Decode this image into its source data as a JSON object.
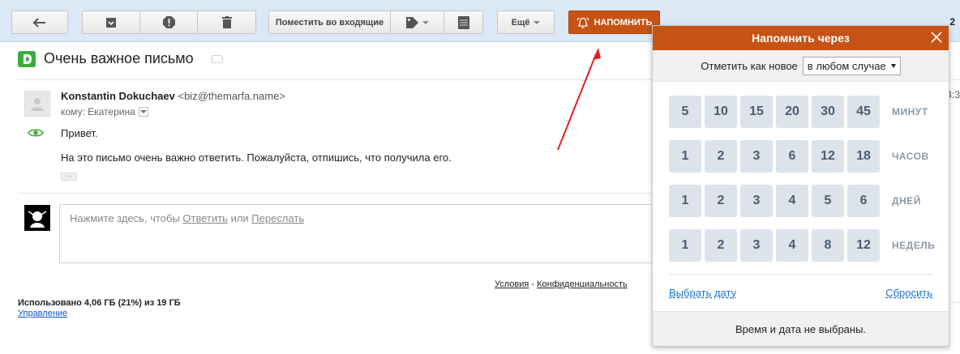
{
  "toolbar": {
    "move_inbox_label": "Поместить во входящие",
    "more_label": "Ещё",
    "remind_label": "НАПОМНИТЬ",
    "page_counter": "2"
  },
  "message": {
    "subject": "Очень важное письмо",
    "sender_name": "Konstantin Dokuchaev",
    "sender_email": "<biz@themarfa.name>",
    "to_line": "кому: Екатерина",
    "greeting": "Привет.",
    "body": "На это письмо очень важно ответить. Пожалуйста, отпишись, что получила его.",
    "ellipsis": "···"
  },
  "reply": {
    "prefix": "Нажмите здесь, чтобы ",
    "reply_link": "Ответить",
    "or": " или ",
    "forward_link": "Переслать"
  },
  "footer": {
    "terms": "Условия",
    "sep": " - ",
    "privacy": "Конфиденциальность",
    "usage": "Использовано 4,06 ГБ (21%) из 19 ГБ",
    "manage": "Управление"
  },
  "edge": {
    "time_fragment": "4:3"
  },
  "popup": {
    "title": "Напомнить через",
    "mark_label": "Отметить как новое",
    "mark_select": "в любом случае",
    "rows": [
      {
        "values": [
          "5",
          "10",
          "15",
          "20",
          "30",
          "45"
        ],
        "unit": "МИНУТ"
      },
      {
        "values": [
          "1",
          "2",
          "3",
          "6",
          "12",
          "18"
        ],
        "unit": "ЧАСОВ"
      },
      {
        "values": [
          "1",
          "2",
          "3",
          "4",
          "5",
          "6"
        ],
        "unit": "ДНЕЙ"
      },
      {
        "values": [
          "1",
          "2",
          "3",
          "4",
          "8",
          "12"
        ],
        "unit": "НЕДЕЛЬ"
      }
    ],
    "pick_date": "Выбрать дату",
    "reset": "Сбросить",
    "status": "Время и дата не выбраны."
  },
  "colors": {
    "accent": "#c65316",
    "link": "#1a73d4",
    "cell_bg": "#dde3ea",
    "cell_text": "#4a5d72",
    "annotation_arrow": "#e02020"
  },
  "icons": [
    "back-arrow-icon",
    "archive-icon",
    "spam-icon",
    "trash-icon",
    "tag-icon",
    "stack-icon",
    "bell-icon",
    "label-icon",
    "eye-icon",
    "user-avatar-icon",
    "close-icon"
  ]
}
